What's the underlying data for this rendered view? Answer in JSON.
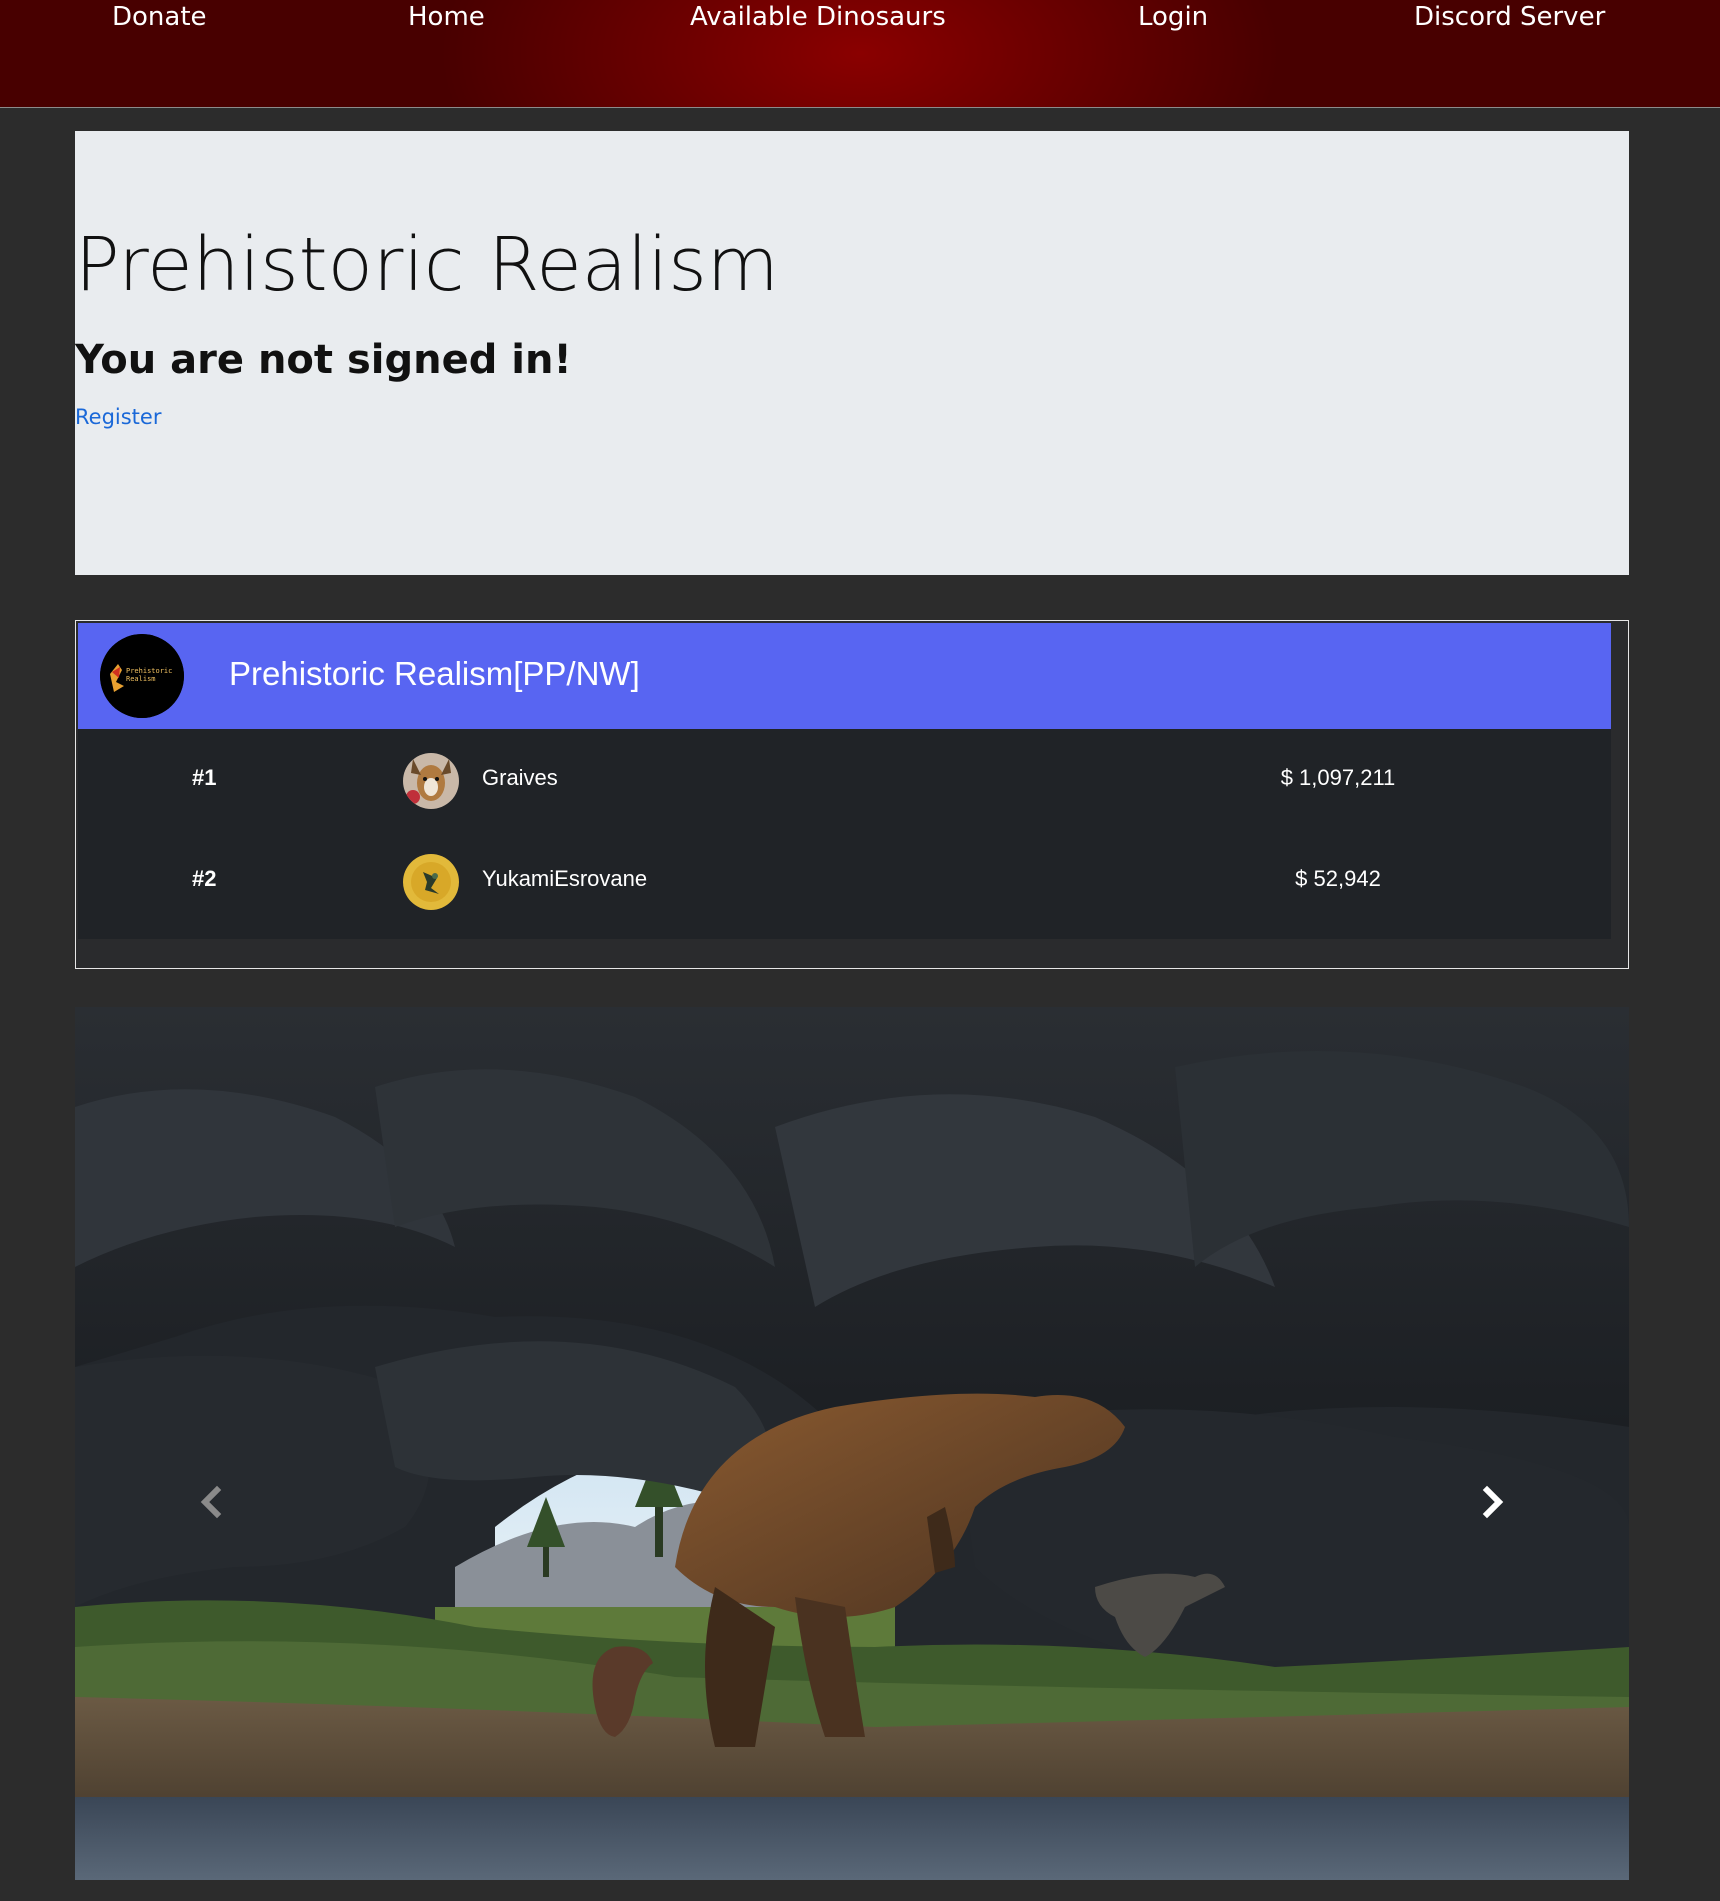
{
  "nav": {
    "items": [
      "Donate",
      "Home",
      "Available Dinosaurs",
      "Login",
      "Discord Server"
    ]
  },
  "jumbotron": {
    "title": "Prehistoric Realism",
    "message": "You are not signed in!",
    "register": "Register"
  },
  "leaderboard": {
    "server_name": "Prehistoric Realism[PP/NW]",
    "logo_text": "Prehistoric Realism",
    "rows": [
      {
        "rank": "#1",
        "name": "Graives",
        "amount": "$ 1,097,211"
      },
      {
        "rank": "#2",
        "name": "YukamiEsrovane",
        "amount": "$ 52,942"
      }
    ]
  },
  "colors": {
    "nav_red": "#7a0000",
    "discord_blurple": "#5865f2",
    "link_blue": "#1a68d8",
    "page_bg": "#2c2c2c"
  },
  "carousel": {
    "controls": [
      "chevron-left-icon",
      "chevron-right-icon"
    ]
  }
}
